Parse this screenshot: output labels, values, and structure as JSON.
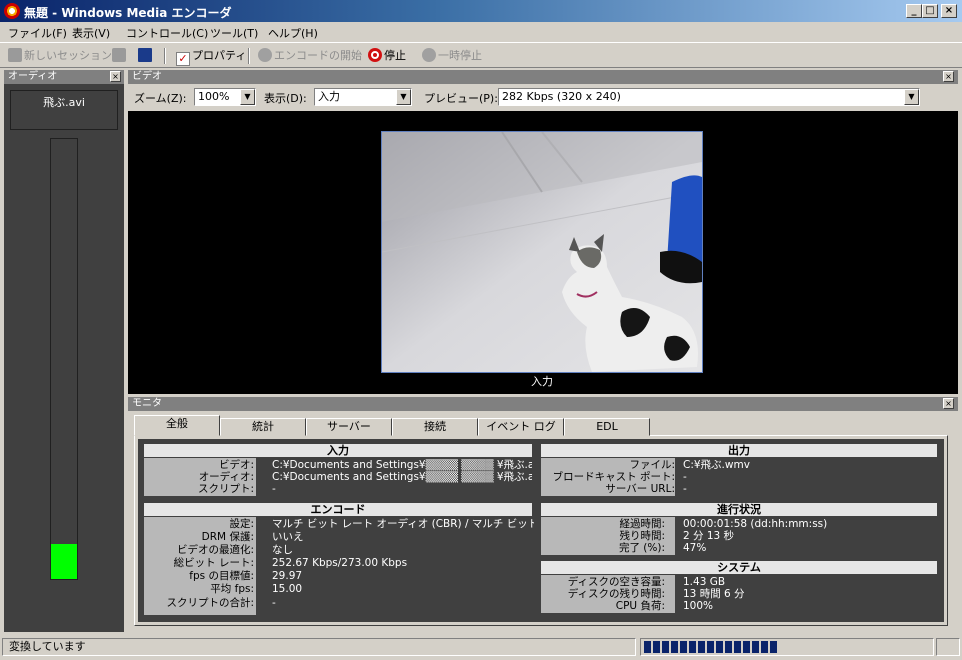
{
  "window": {
    "title": "無題 - Windows Media エンコーダ",
    "min_label": "_",
    "max_label": "□",
    "close_label": "×"
  },
  "menu": [
    "ファイル(F)",
    "表示(V)",
    "コントロール(C)",
    "ツール(T)",
    "ヘルプ(H)"
  ],
  "toolbar": {
    "new_session": "新しいセッション",
    "properties": "プロパティ",
    "start_encoding": "エンコードの開始",
    "stop": "停止",
    "pause": "一時停止"
  },
  "audio": {
    "header": "オーディオ",
    "file": "飛ぶ.avi",
    "level": 0.08
  },
  "video": {
    "header": "ビデオ",
    "zoom_label": "ズーム(Z):",
    "zoom_value": "100%",
    "view_label": "表示(D):",
    "view_value": "入力",
    "preview_label": "プレビュー(P):",
    "preview_value": "282 Kbps (320 x 240)",
    "preview_caption": "入力"
  },
  "monitor": {
    "header": "モニタ",
    "tabs": [
      "全般",
      "統計",
      "サーバー",
      "接続",
      "イベント ログ",
      "EDL"
    ],
    "input": {
      "title": "入力",
      "rows": [
        {
          "key": "ビデオ:",
          "value": "C:¥Documents and Settings¥▒▒▒▒ ▒▒▒▒ ¥飛ぶ.avi"
        },
        {
          "key": "オーディオ:",
          "value": "C:¥Documents and Settings¥▒▒▒▒ ▒▒▒▒ ¥飛ぶ.avi"
        },
        {
          "key": "スクリプト:",
          "value": "-"
        }
      ]
    },
    "output": {
      "title": "出力",
      "rows": [
        {
          "key": "ファイル:",
          "value": "C:¥飛ぶ.wmv"
        },
        {
          "key": "ブロードキャスト ポート:",
          "value": "-"
        },
        {
          "key": "サーバー URL:",
          "value": "-"
        }
      ]
    },
    "encode": {
      "title": "エンコード",
      "rows": [
        {
          "key": "設定:",
          "value": "マルチ ビット レート オーディオ (CBR) / マルチ ビット レ"
        },
        {
          "key": "DRM 保護:",
          "value": "いいえ"
        },
        {
          "key": "ビデオの最適化:",
          "value": "なし"
        },
        {
          "key": "総ビット レート:",
          "value": "252.67 Kbps/273.00 Kbps"
        },
        {
          "key": "fps の目標値:",
          "value": "29.97"
        },
        {
          "key": "平均 fps:",
          "value": "15.00"
        },
        {
          "key": "スクリプトの合計:",
          "value": "-"
        }
      ]
    },
    "progress": {
      "title": "進行状況",
      "rows": [
        {
          "key": "経過時間:",
          "value": "00:00:01:58  (dd:hh:mm:ss)"
        },
        {
          "key": "残り時間:",
          "value": "2 分 13 秒"
        },
        {
          "key": "完了 (%):",
          "value": "47%"
        }
      ]
    },
    "system": {
      "title": "システム",
      "rows": [
        {
          "key": "ディスクの空き容量:",
          "value": "1.43 GB"
        },
        {
          "key": "ディスクの残り時間:",
          "value": "13 時間 6 分"
        },
        {
          "key": "CPU 負荷:",
          "value": "100%"
        }
      ]
    }
  },
  "status": {
    "text": "変換しています",
    "progress_fraction": 0.48
  }
}
